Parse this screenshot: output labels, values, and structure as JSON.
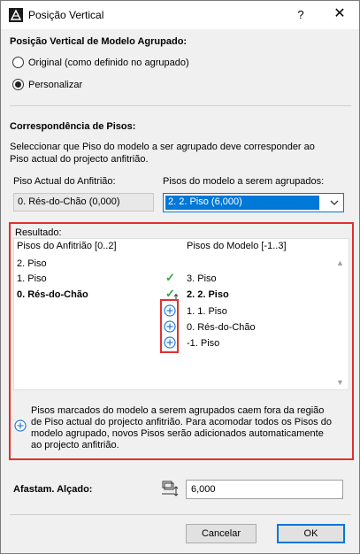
{
  "window": {
    "title": "Posição Vertical",
    "help_label": "?",
    "close_label": "✕"
  },
  "vertical_position": {
    "heading": "Posição Vertical de Modelo Agrupado:",
    "option_original": "Original (como definido no agrupado)",
    "option_custom": "Personalizar",
    "selected": "custom"
  },
  "floor_match": {
    "heading": "Correspondência de Pisos:",
    "description_line1": "Seleccionar que Piso do modelo a ser agrupado deve corresponder ao",
    "description_line2": "Piso actual do projecto anfitrião.",
    "host_floor_label": "Piso Actual do Anfitrião:",
    "host_floor_value": "0. Rés-do-Chão (0,000)",
    "model_floor_label": "Pisos do modelo a serem agrupados:",
    "model_floor_value": "2. 2. Piso (6,000)"
  },
  "result": {
    "heading": "Resultado:",
    "col_host": "Pisos do Anfitrião [0..2]",
    "col_model": "Pisos do Modelo [-1..3]",
    "rows": [
      {
        "host": "2. Piso",
        "model": "",
        "marker": "none",
        "bold": false
      },
      {
        "host": "1. Piso",
        "model": "3. Piso",
        "marker": "check",
        "bold": false
      },
      {
        "host": "0. Rés-do-Chão",
        "model": "2. 2. Piso",
        "marker": "check",
        "bold": true
      },
      {
        "host": "",
        "model": "1. 1. Piso",
        "marker": "plus",
        "bold": false
      },
      {
        "host": "",
        "model": "0. Rés-do-Chão",
        "marker": "plus",
        "bold": false
      },
      {
        "host": "",
        "model": "-1. Piso",
        "marker": "plus",
        "bold": false
      }
    ],
    "note_line1": "Pisos marcados do modelo a serem agrupados caem fora da região",
    "note_line2": "de Piso actual do projecto anfitrião. Para acomodar todos os Pisos do",
    "note_line3": "modelo agrupado, novos Pisos serão adicionados automaticamente",
    "note_line4": "ao projecto anfitrião."
  },
  "offset": {
    "label": "Afastam. Alçado:",
    "value": "6,000"
  },
  "buttons": {
    "cancel": "Cancelar",
    "ok": "OK"
  },
  "colors": {
    "accent": "#0078d7",
    "highlight_border": "#e03030",
    "check": "#2ea84b"
  },
  "icons": {
    "app": "archicad-icon",
    "match": "check-icon",
    "add": "plus-circle-icon",
    "offset": "elevation-offset-icon"
  }
}
